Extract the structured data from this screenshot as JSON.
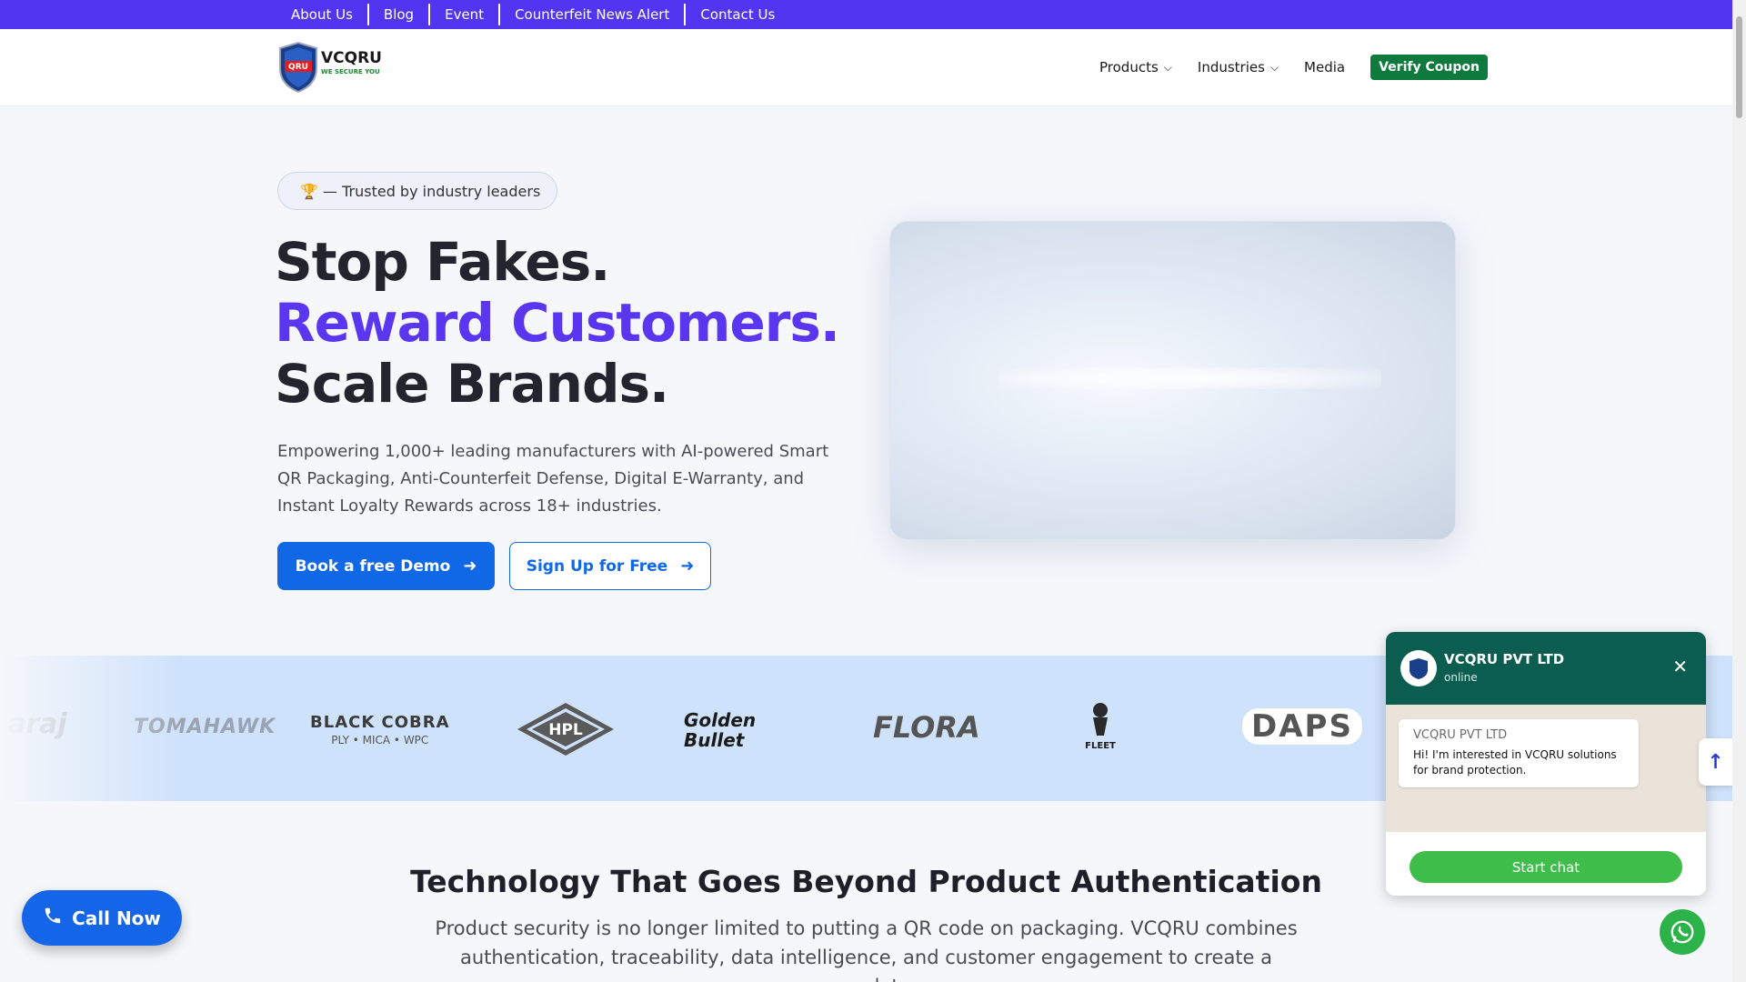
{
  "topbar": {
    "links": [
      "About Us",
      "Blog",
      "Event",
      "Counterfeit News Alert",
      "Contact Us"
    ],
    "color": "#5235f0"
  },
  "header": {
    "logo": {
      "text": "VCQRU",
      "tagline": "WE SECURE YOU",
      "seal_text": "QRU"
    },
    "nav": {
      "products": "Products",
      "industries": "Industries",
      "media": "Media",
      "verify": "Verify Coupon"
    }
  },
  "hero": {
    "badge_icon": "trophy-icon",
    "badge_text": "🏆 — Trusted by industry leaders",
    "line1": "Stop Fakes.",
    "line2": "Reward Customers.",
    "line3": "Scale Brands.",
    "subtext": "Empowering 1,000+ leading manufacturers with AI-powered Smart QR Packaging, Anti-Counterfeit Defense, Digital E-Warranty, and Instant Loyalty Rewards across 18+ industries.",
    "primary_button": "Book a free Demo",
    "secondary_button": "Sign Up for Free",
    "accent_color": "#5a36f0",
    "button_color": "#1068e6"
  },
  "brands": [
    {
      "name": "araj"
    },
    {
      "name": "TOMAHAWK"
    },
    {
      "name": "BLACK COBRA",
      "sub": "PLY • MICA • WPC"
    },
    {
      "name": "HPL"
    },
    {
      "name": "Golden Bullet"
    },
    {
      "name": "FLORA"
    },
    {
      "name": "FLEET"
    },
    {
      "name": "DAPS"
    }
  ],
  "section": {
    "title": "Technology That Goes Beyond Product Authentication",
    "text": "Product security is no longer limited to putting a QR code on packaging. VCQRU combines authentication, traceability, data intelligence, and customer engagement to create a complete"
  },
  "call_now": {
    "label": "Call Now",
    "icon": "phone-icon"
  },
  "chat_widget": {
    "name": "VCQRU PVT LTD",
    "status": "online",
    "bubble_name": "VCQRU PVT LTD",
    "bubble_text": "Hi! I'm interested in VCQRU solutions for brand protection.",
    "start_label": "Start chat",
    "header_color": "#0b5e4f",
    "button_color": "#3ebd4a"
  },
  "scroll_top_icon": "arrow-up-icon",
  "whatsapp_icon": "whatsapp-icon"
}
